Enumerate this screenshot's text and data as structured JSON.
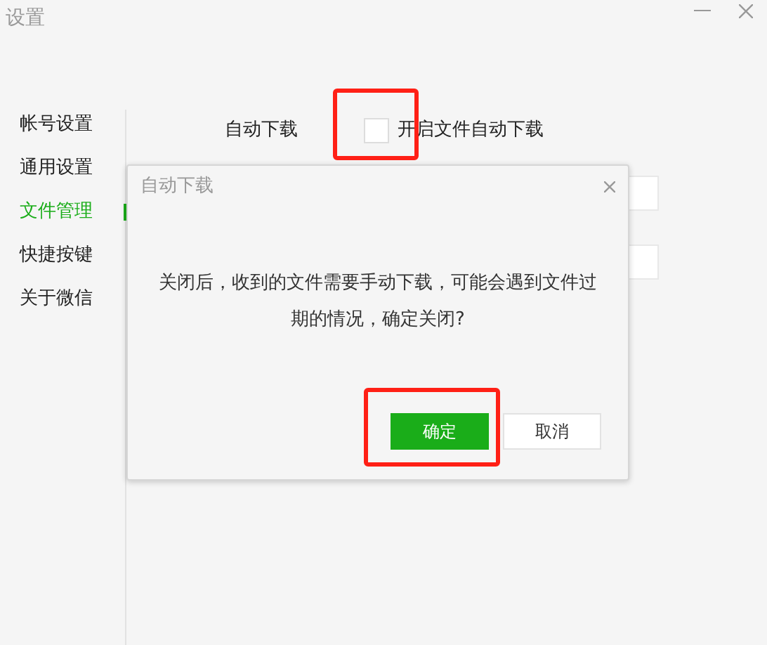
{
  "window": {
    "title": "设置"
  },
  "sidebar": {
    "items": [
      {
        "label": "帐号设置",
        "selected": false
      },
      {
        "label": "通用设置",
        "selected": false
      },
      {
        "label": "文件管理",
        "selected": true
      },
      {
        "label": "快捷按键",
        "selected": false
      },
      {
        "label": "关于微信",
        "selected": false
      }
    ]
  },
  "content": {
    "label": "自动下载",
    "checkbox": {
      "label": "开启文件自动下载",
      "checked": false,
      "highlighted": true
    }
  },
  "dialog": {
    "title": "自动下载",
    "message": "关闭后，收到的文件需要手动下载，可能会遇到文件过期的情况，确定关闭?",
    "buttons": [
      {
        "label": "确定",
        "kind": "primary",
        "highlighted": true
      },
      {
        "label": "取消",
        "kind": "secondary",
        "highlighted": false
      }
    ]
  }
}
